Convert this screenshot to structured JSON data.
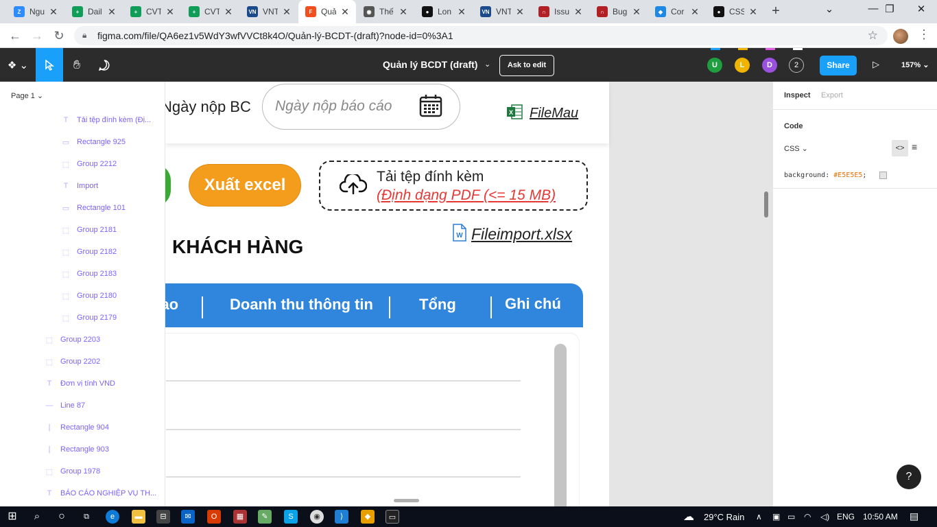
{
  "browser": {
    "tabs": [
      {
        "title": "Ngu",
        "icon": "zoom-icon",
        "color": "#2d8cff",
        "glyph": "Z"
      },
      {
        "title": "Dail",
        "icon": "sheets-icon",
        "color": "#0f9d58",
        "glyph": "+"
      },
      {
        "title": "CVT",
        "icon": "sheets-icon",
        "color": "#0f9d58",
        "glyph": "+"
      },
      {
        "title": "CVT",
        "icon": "sheets-icon",
        "color": "#0f9d58",
        "glyph": "+"
      },
      {
        "title": "VNT",
        "icon": "vnta-icon",
        "color": "#1a4a8a",
        "glyph": "VN"
      },
      {
        "title": "Quả",
        "icon": "figma-icon",
        "color": "#f24e1e",
        "glyph": "F"
      },
      {
        "title": "Thế",
        "icon": "chrome-icon",
        "color": "#555555",
        "glyph": "◉"
      },
      {
        "title": "Lon",
        "icon": "github-icon",
        "color": "#111111",
        "glyph": "●"
      },
      {
        "title": "VNT",
        "icon": "vnta-icon",
        "color": "#1a4a8a",
        "glyph": "VN"
      },
      {
        "title": "Issu",
        "icon": "redmine-icon",
        "color": "#b32024",
        "glyph": "∩"
      },
      {
        "title": "Bug",
        "icon": "redmine-icon",
        "color": "#b32024",
        "glyph": "∩"
      },
      {
        "title": "Cor",
        "icon": "cube-icon",
        "color": "#1e88e5",
        "glyph": "◆"
      },
      {
        "title": "CSS",
        "icon": "github-icon",
        "color": "#111111",
        "glyph": "●"
      }
    ],
    "active_tab": 5,
    "url": "figma.com/file/QA6ez1v5WdY3wfVVCt8k4O/Quản-lý-BCDT-(draft)?node-id=0%3A1"
  },
  "figma": {
    "file_title": "Quản lý BCDT (draft)",
    "ask_to_edit": "Ask to edit",
    "avatars": [
      {
        "letter": "U",
        "color": "#1e9e3e"
      },
      {
        "letter": "L",
        "color": "#f0b400"
      },
      {
        "letter": "D",
        "color": "#9b51e0"
      }
    ],
    "avatar_count": "2",
    "share": "Share",
    "zoom": "157%",
    "accent": "#18a0fb"
  },
  "layers": {
    "page": "Page 1",
    "items": [
      {
        "label": "Tải tệp đính kèm (Đị...",
        "kind": "text",
        "glyph": "T",
        "indent": 1
      },
      {
        "label": "Rectangle 925",
        "kind": "rect",
        "glyph": "▭",
        "indent": 1
      },
      {
        "label": "Group 2212",
        "kind": "group",
        "glyph": "⬚",
        "indent": 1
      },
      {
        "label": "Import",
        "kind": "text",
        "glyph": "T",
        "indent": 1
      },
      {
        "label": "Rectangle 101",
        "kind": "rect",
        "glyph": "▭",
        "indent": 1
      },
      {
        "label": "Group 2181",
        "kind": "group",
        "glyph": "⬚",
        "indent": 1
      },
      {
        "label": "Group 2182",
        "kind": "group",
        "glyph": "⬚",
        "indent": 1
      },
      {
        "label": "Group 2183",
        "kind": "group",
        "glyph": "⬚",
        "indent": 1
      },
      {
        "label": "Group 2180",
        "kind": "group",
        "glyph": "⬚",
        "indent": 1
      },
      {
        "label": "Group 2179",
        "kind": "group",
        "glyph": "⬚",
        "indent": 1
      },
      {
        "label": "Group 2203",
        "kind": "group",
        "glyph": "⬚",
        "indent": 0
      },
      {
        "label": "Group 2202",
        "kind": "group",
        "glyph": "⬚",
        "indent": 0
      },
      {
        "label": "Đơn vị tính VND",
        "kind": "text",
        "glyph": "T",
        "indent": 0
      },
      {
        "label": "Line 87",
        "kind": "line",
        "glyph": "—",
        "indent": 0
      },
      {
        "label": "Rectangle 904",
        "kind": "rect",
        "glyph": "|",
        "indent": 0
      },
      {
        "label": "Rectangle 903",
        "kind": "rect",
        "glyph": "|",
        "indent": 0
      },
      {
        "label": "Group 1978",
        "kind": "group",
        "glyph": "⬚",
        "indent": 0
      },
      {
        "label": "BÁO CÁO NGHIỆP VỤ TH...",
        "kind": "text",
        "glyph": "T",
        "indent": 0
      }
    ]
  },
  "canvas": {
    "date_label": "Ngày nộp BC",
    "date_placeholder": "Ngày nộp báo cáo",
    "file_mau": "FileMau",
    "export_excel": "Xuất excel",
    "upload_title": "Tải tệp đính kèm",
    "upload_hint": "(Định dạng PDF (<= 15 MB)",
    "file_import": "Fileimport.xlsx",
    "section_title": "KHÁCH HÀNG",
    "table_headers": [
      "bao",
      "Doanh thu thông tin",
      "Tổng",
      "Ghi chú"
    ],
    "header_color": "#2f86dc",
    "excel_color": "#f49c1c",
    "green_color": "#3aaa35",
    "upload_hint_color": "#e53935"
  },
  "inspect": {
    "tab_inspect": "Inspect",
    "tab_export": "Export",
    "code_title": "Code",
    "language": "CSS",
    "code_prop": "background:",
    "code_value": "#E5E5E5",
    "code_end": ";"
  },
  "taskbar": {
    "weather": "29°C  Rain",
    "lang": "ENG",
    "time": "10:50 AM"
  }
}
